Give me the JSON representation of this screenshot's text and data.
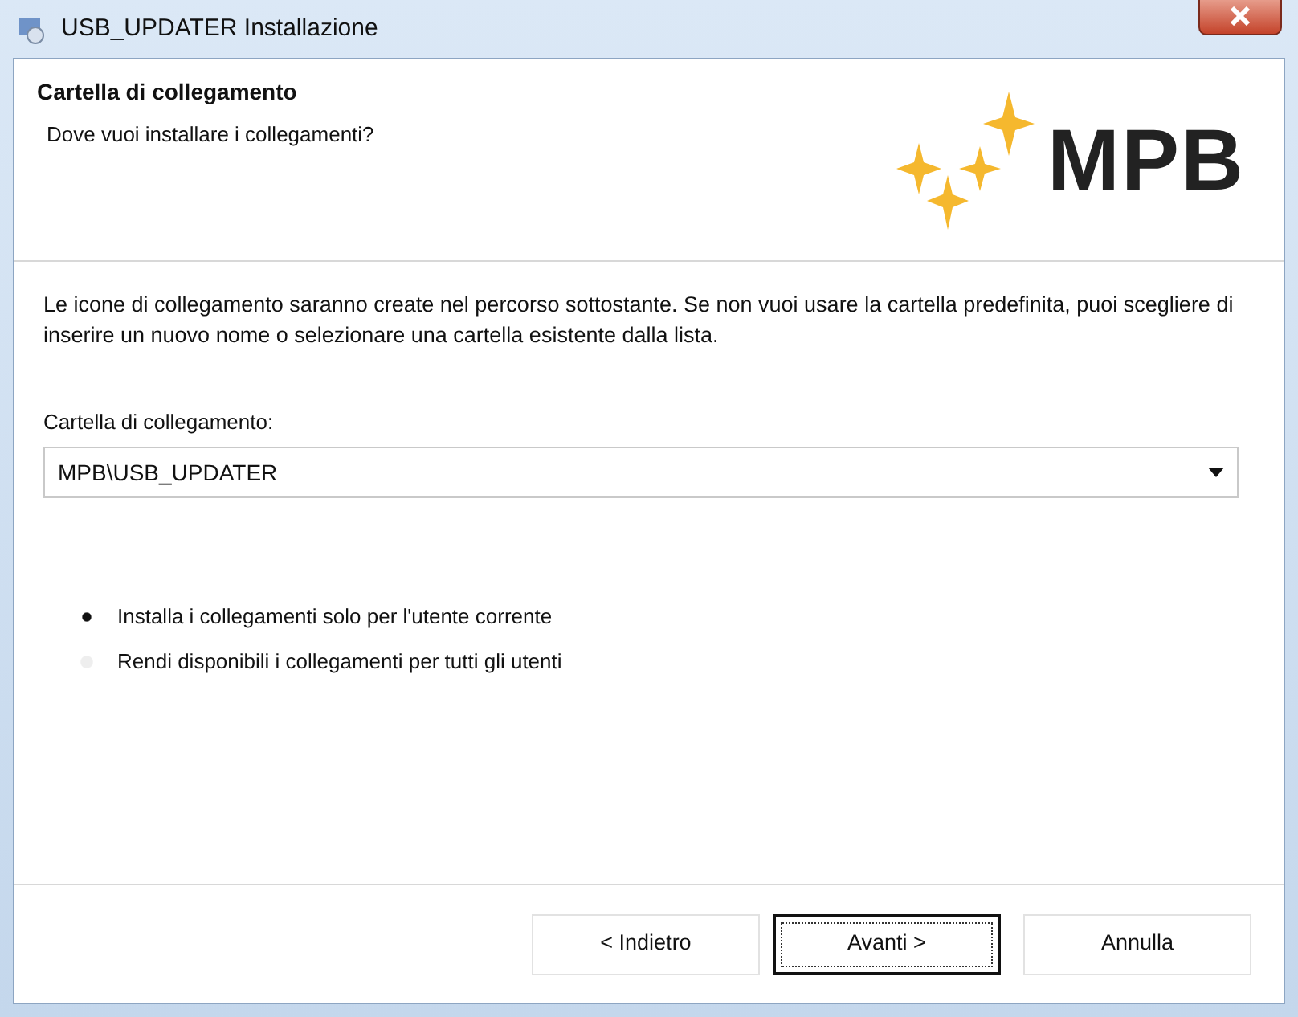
{
  "window": {
    "title": "USB_UPDATER Installazione"
  },
  "header": {
    "title": "Cartella di collegamento",
    "subtitle": "Dove vuoi installare i collegamenti?",
    "logo_text": "MPB"
  },
  "description": "Le icone di collegamento saranno create nel percorso sottostante. Se non vuoi usare la cartella predefinita, puoi scegliere di inserire un nuovo nome o selezionare una cartella esistente dalla lista.",
  "folder_field": {
    "label": "Cartella di collegamento:",
    "value": "MPB\\USB_UPDATER"
  },
  "options": [
    {
      "label": "Installa i collegamenti solo per l'utente corrente",
      "selected": true
    },
    {
      "label": "Rendi disponibili i collegamenti per tutti gli utenti",
      "selected": false
    }
  ],
  "buttons": [
    {
      "label": "< Indietro",
      "default": false
    },
    {
      "label": "Avanti >",
      "default": true
    },
    {
      "label": "Annulla",
      "default": false
    }
  ]
}
